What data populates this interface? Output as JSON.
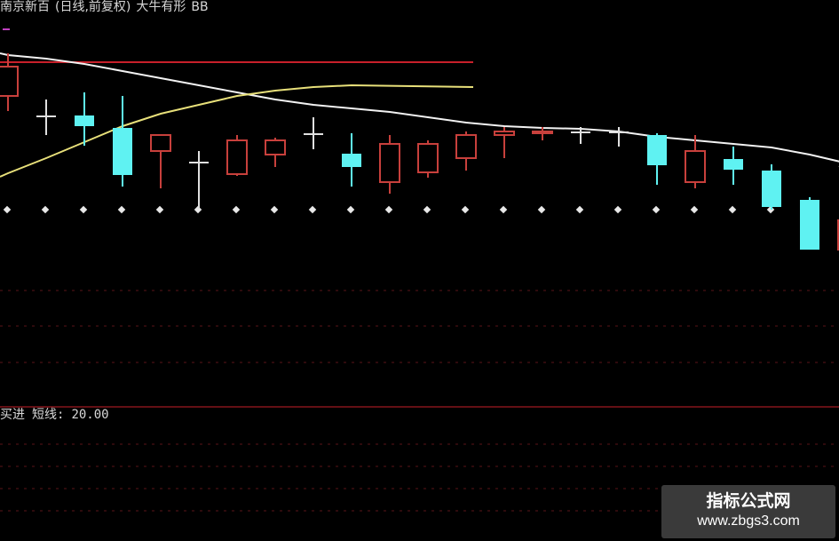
{
  "header": {
    "stock_name": "南京新百",
    "period_info": "(日线,前复权)",
    "indicator_name": "大牛有形",
    "trailing_text": "BB"
  },
  "indicator_pane": {
    "label": "买进",
    "line_label": "短线:",
    "line_value": "20.00"
  },
  "watermark": {
    "title": "指标公式网",
    "url": "www.zbgs3.com"
  },
  "colors": {
    "background": "#000000",
    "up_candle": "#c8403c",
    "down_candle": "#5ff2f2",
    "neutral_candle": "#e0e0e0",
    "ma_long": "#f2f2f2",
    "ma_short": "#e8e07a",
    "level_line": "#c8202a",
    "dots": "#e8e8e8",
    "grid_dash": "#5a1418"
  },
  "chart_data": {
    "type": "candlestick",
    "price_axis": "inverted pixel scale (price labels not shown)",
    "candles": [
      {
        "o": 108,
        "h": 125,
        "l": 60,
        "c": 75
      },
      {
        "o": 130,
        "h": 152,
        "l": 112,
        "c": 130
      },
      {
        "o": 130,
        "h": 164,
        "l": 104,
        "c": 142
      },
      {
        "o": 144,
        "h": 210,
        "l": 108,
        "c": 197
      },
      {
        "o": 170,
        "h": 212,
        "l": 152,
        "c": 152
      },
      {
        "o": 182,
        "h": 235,
        "l": 170,
        "c": 182
      },
      {
        "o": 196,
        "h": 198,
        "l": 152,
        "c": 158
      },
      {
        "o": 174,
        "h": 188,
        "l": 155,
        "c": 158
      },
      {
        "o": 150,
        "h": 168,
        "l": 132,
        "c": 150
      },
      {
        "o": 173,
        "h": 210,
        "l": 150,
        "c": 188
      },
      {
        "o": 205,
        "h": 218,
        "l": 152,
        "c": 162
      },
      {
        "o": 194,
        "h": 200,
        "l": 158,
        "c": 162
      },
      {
        "o": 178,
        "h": 192,
        "l": 148,
        "c": 152
      },
      {
        "o": 152,
        "h": 178,
        "l": 143,
        "c": 148
      },
      {
        "o": 150,
        "h": 158,
        "l": 143,
        "c": 148
      },
      {
        "o": 148,
        "h": 162,
        "l": 143,
        "c": 148
      },
      {
        "o": 148,
        "h": 165,
        "l": 143,
        "c": 148
      },
      {
        "o": 152,
        "h": 208,
        "l": 150,
        "c": 186
      },
      {
        "o": 205,
        "h": 212,
        "l": 152,
        "c": 170
      },
      {
        "o": 179,
        "h": 208,
        "l": 165,
        "c": 191
      },
      {
        "o": 192,
        "h": 236,
        "l": 185,
        "c": 233
      },
      {
        "o": 225,
        "h": 281,
        "l": 222,
        "c": 281
      },
      {
        "o": 281,
        "h": 281,
        "l": 248,
        "c": 248
      }
    ],
    "ma_long": [
      62,
      66,
      72,
      80,
      88,
      96,
      104,
      112,
      118,
      122,
      126,
      132,
      138,
      142,
      144,
      145,
      148,
      154,
      158,
      162,
      166,
      174,
      184
    ],
    "ma_short": [
      195,
      178,
      160,
      142,
      128,
      118,
      108,
      102,
      98,
      96
    ],
    "level_line_value": 70,
    "dots_value": 236
  }
}
